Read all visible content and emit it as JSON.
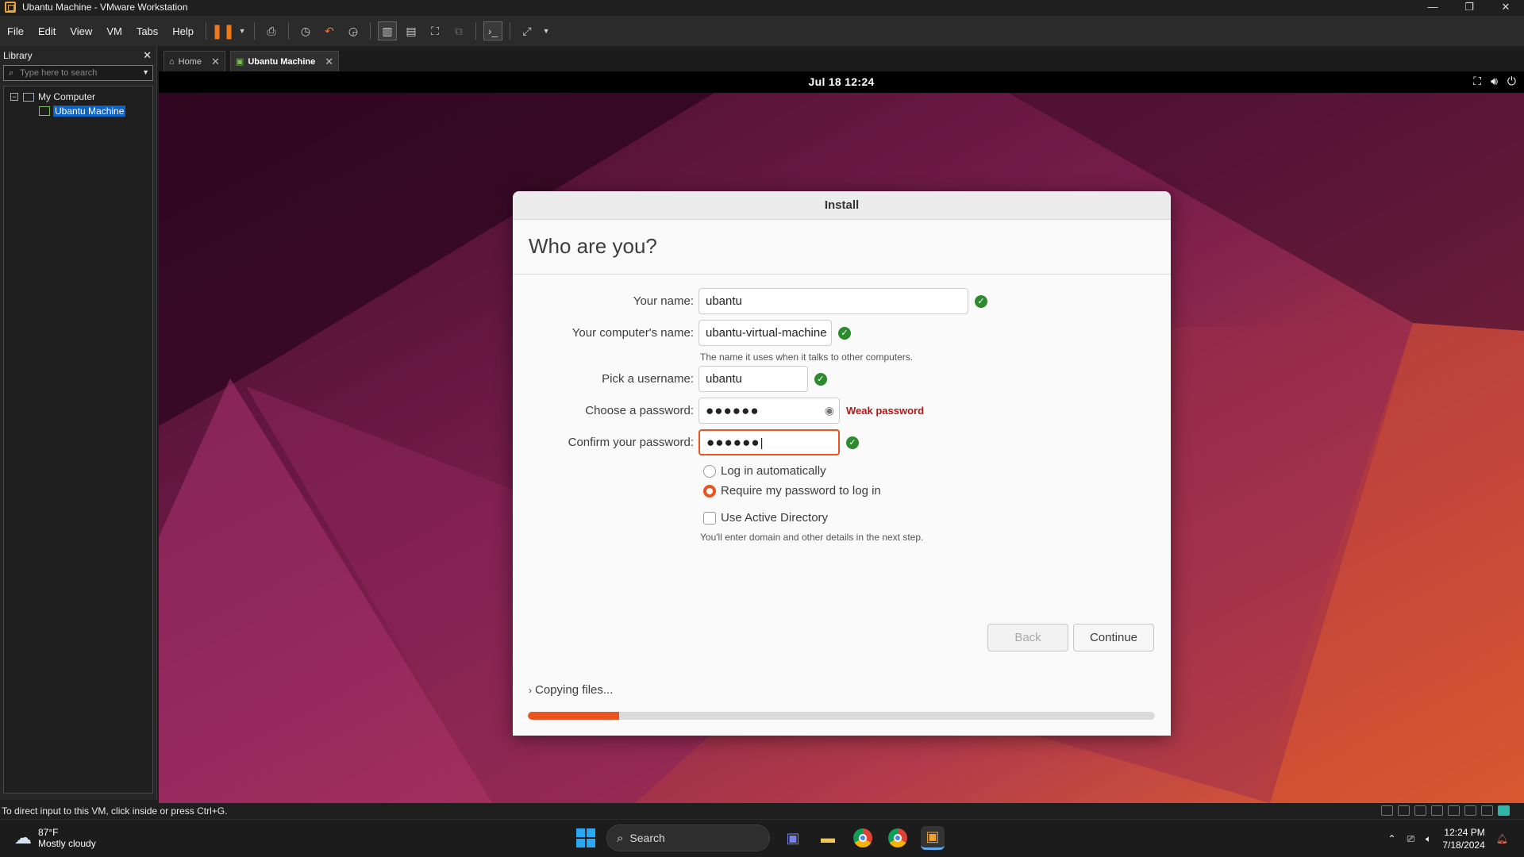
{
  "window": {
    "title": "Ubantu Machine - VMware Workstation",
    "controls": {
      "minimize": "—",
      "restore": "❐",
      "close": "✕"
    }
  },
  "menu": [
    "File",
    "Edit",
    "View",
    "VM",
    "Tabs",
    "Help"
  ],
  "library": {
    "title": "Library",
    "search_placeholder": "Type here to search",
    "tree": {
      "root": "My Computer",
      "child": "Ubantu Machine"
    }
  },
  "tabs": [
    {
      "label": "Home",
      "active": false
    },
    {
      "label": "Ubantu Machine",
      "active": true
    }
  ],
  "vm": {
    "topbar_clock": "Jul 18  12:24",
    "installer": {
      "window_title": "Install",
      "heading": "Who are you?",
      "fields": {
        "name_label": "Your name:",
        "name_value": "ubantu",
        "computer_label": "Your computer's name:",
        "computer_value": "ubantu-virtual-machine",
        "computer_hint": "The name it uses when it talks to other computers.",
        "username_label": "Pick a username:",
        "username_value": "ubantu",
        "password_label": "Choose a password:",
        "password_value": "●●●●●●",
        "password_strength": "Weak password",
        "confirm_label": "Confirm your password:",
        "confirm_value": "●●●●●●"
      },
      "options": {
        "auto_login": "Log in automatically",
        "require_password": "Require my password to log in",
        "active_directory": "Use Active Directory",
        "ad_hint": "You'll enter domain and other details in the next step.",
        "selected": "require_password"
      },
      "buttons": {
        "back": "Back",
        "continue": "Continue"
      },
      "progress": {
        "label": "Copying files...",
        "fraction": 0.146
      }
    }
  },
  "statusbar": {
    "message": "To direct input to this VM, click inside or press Ctrl+G."
  },
  "taskbar": {
    "weather_temp": "87°F",
    "weather_desc": "Mostly cloudy",
    "search_label": "Search",
    "time": "12:24 PM",
    "date": "7/18/2024"
  },
  "colors": {
    "accent": "#e95420",
    "ok": "#2d8a2d",
    "warning": "#b01818",
    "selection": "#0a63c9"
  }
}
